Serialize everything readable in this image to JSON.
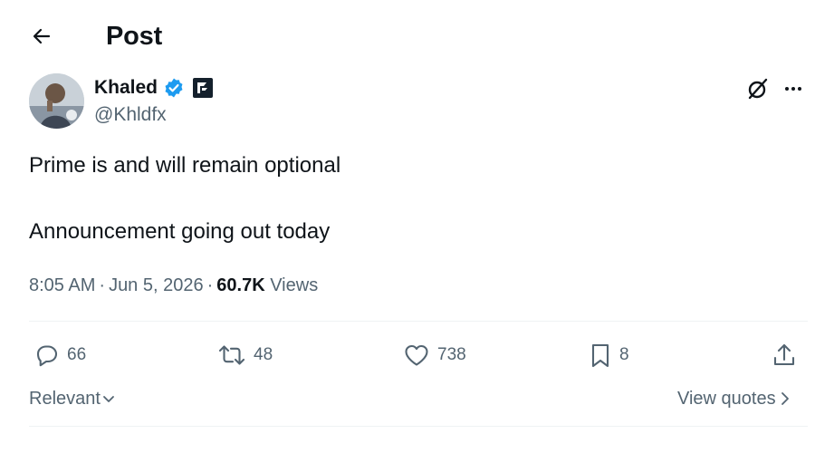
{
  "header": {
    "title": "Post",
    "back_icon": "arrow-left-icon"
  },
  "author": {
    "display_name": "Khaled",
    "handle": "@Khldfx",
    "verified_color": "#1d9bf0",
    "affiliation_badge": "square-logo-badge"
  },
  "post": {
    "lines": [
      "Prime is and will remain optional",
      "Announcement going out today"
    ],
    "time": "8:05 AM",
    "date": "Jun 5, 2026",
    "views_count": "60.7K",
    "views_label": "Views"
  },
  "actions": {
    "replies": "66",
    "reposts": "48",
    "likes": "738",
    "bookmarks": "8"
  },
  "footer": {
    "sort_label": "Relevant",
    "quotes_label": "View quotes"
  },
  "colors": {
    "text": "#0f1419",
    "muted": "#536471",
    "accent": "#1d9bf0",
    "divider": "#eff3f4"
  }
}
